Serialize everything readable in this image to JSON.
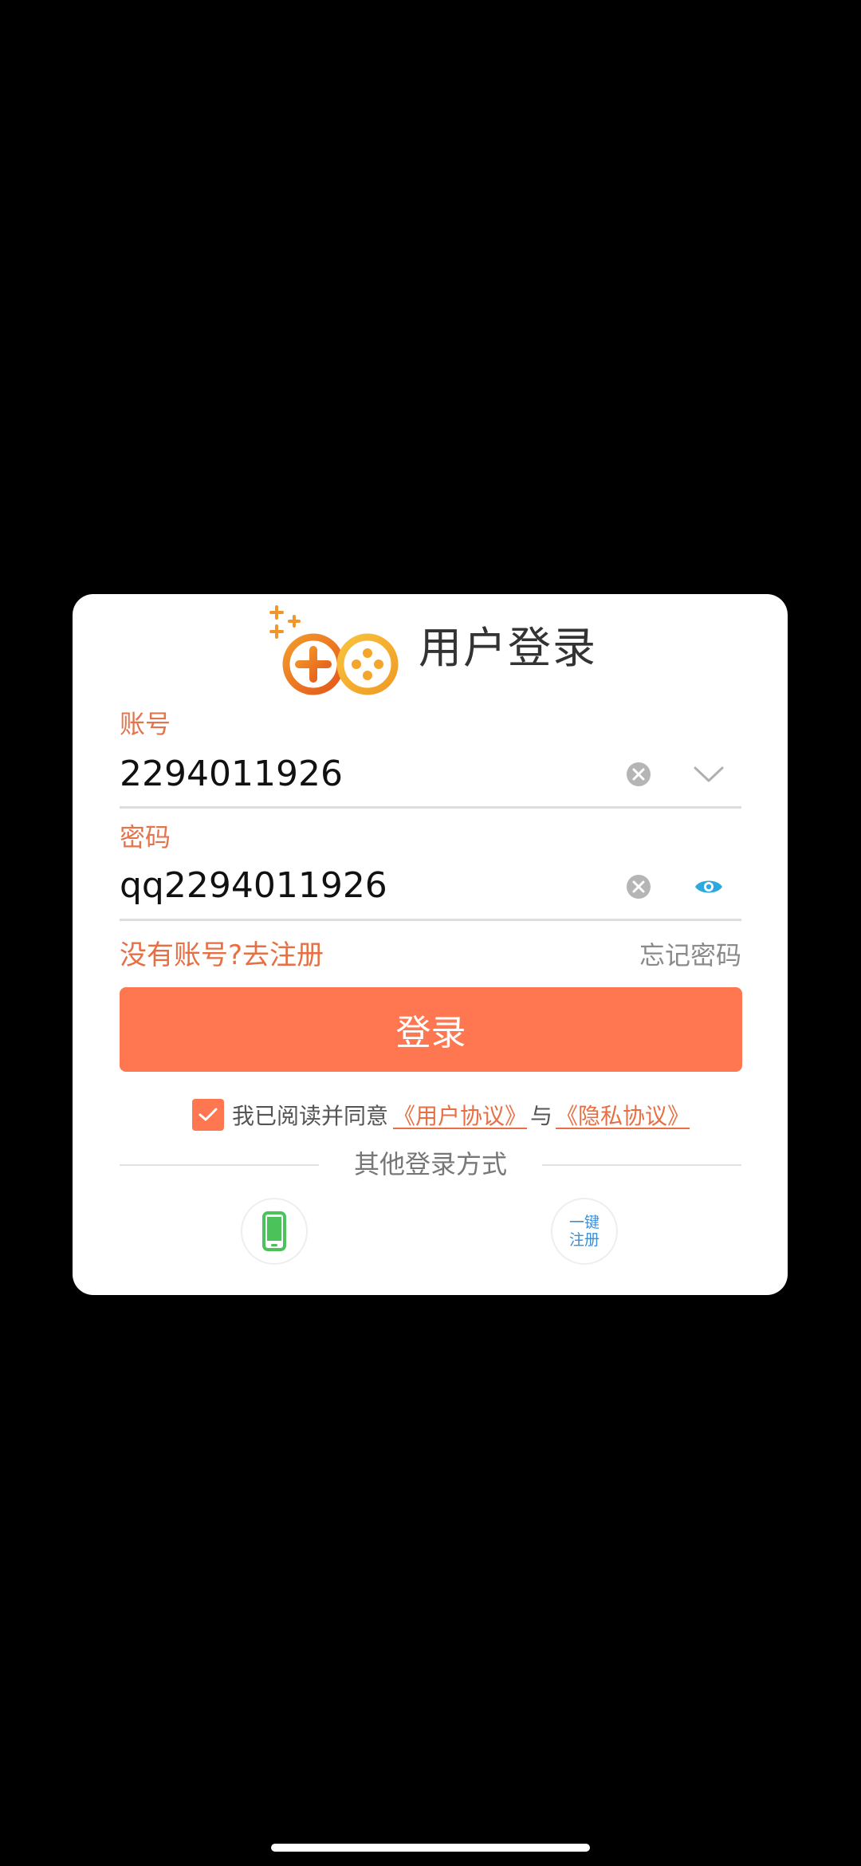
{
  "colors": {
    "accent": "#ff7750",
    "label": "#e4744c",
    "link": "#e76f43",
    "muted": "#8a8a8a",
    "eye": "#2ea9e0",
    "phone": "#4cc25b",
    "quick_reg": "#3a8fd8"
  },
  "dialog": {
    "title": "用户登录",
    "logo_icon": "gamepad-logo-icon"
  },
  "account": {
    "label": "账号",
    "value": "2294011926",
    "clear_icon": "clear-icon",
    "dropdown_icon": "chevron-down-icon"
  },
  "password": {
    "label": "密码",
    "value": "qq2294011926",
    "clear_icon": "clear-icon",
    "visibility_icon": "eye-icon"
  },
  "links": {
    "register": "没有账号?去注册",
    "forgot": "忘记密码"
  },
  "login_button": "登录",
  "agreement": {
    "checked": true,
    "prefix": "我已阅读并同意",
    "user_protocol": "《用户协议》",
    "and": "与",
    "privacy_protocol": "《隐私协议》"
  },
  "other_login": {
    "title": "其他登录方式",
    "phone_icon": "phone-icon",
    "quick_register_line1": "一键",
    "quick_register_line2": "注册"
  }
}
